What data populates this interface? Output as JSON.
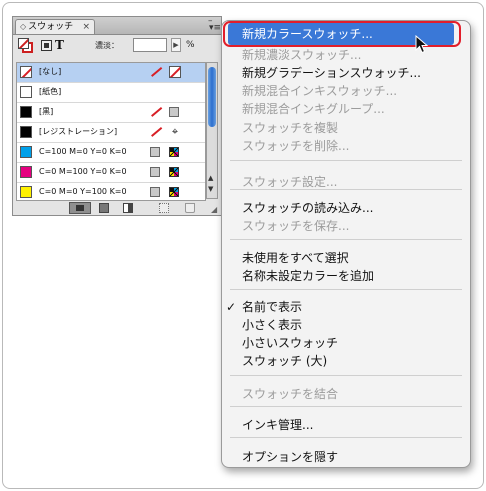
{
  "panel": {
    "tab_grip": "◇",
    "tab_label": "スウォッチ",
    "tab_close": "×",
    "minimize": "–",
    "menu_glyph": "▾≡",
    "tint_label": "濃淡：",
    "tint_value": "",
    "tint_arrow": "▶",
    "percent": "%",
    "text_icon_label": "T",
    "scroll_up": "▲",
    "scroll_down": "▼",
    "resize_glyph": "◢",
    "swatches": [
      {
        "name": "[なし]",
        "color": "none",
        "icons": [
          "no-edit",
          "none-box"
        ],
        "selected": true
      },
      {
        "name": "[紙色]",
        "color": "#ffffff",
        "icons": [],
        "selected": false
      },
      {
        "name": "[黒]",
        "color": "#000000",
        "icons": [
          "no-edit",
          "process-gray"
        ],
        "selected": false
      },
      {
        "name": "[レジストレーション]",
        "color": "#000000",
        "icons": [
          "no-edit",
          "registration"
        ],
        "selected": false
      },
      {
        "name": "C=100 M=0 Y=0 K=0",
        "color": "#00a0e9",
        "icons": [
          "process-gray",
          "cmyk"
        ],
        "selected": false
      },
      {
        "name": "C=0 M=100 Y=0 K=0",
        "color": "#e4007f",
        "icons": [
          "process-gray",
          "cmyk"
        ],
        "selected": false
      },
      {
        "name": "C=0 M=0 Y=100 K=0",
        "color": "#fff100",
        "icons": [
          "process-gray",
          "cmyk"
        ],
        "selected": false
      }
    ]
  },
  "menu": {
    "items": [
      {
        "label": "新規カラースウォッチ...",
        "state": "highlighted"
      },
      {
        "label": "新規濃淡スウォッチ...",
        "state": "disabled"
      },
      {
        "label": "新規グラデーションスウォッチ...",
        "state": "enabled"
      },
      {
        "label": "新規混合インキスウォッチ...",
        "state": "disabled"
      },
      {
        "label": "新規混合インキグループ...",
        "state": "disabled"
      },
      {
        "label": "スウォッチを複製",
        "state": "disabled"
      },
      {
        "label": "スウォッチを削除...",
        "state": "disabled"
      },
      {
        "label": "スウォッチ設定...",
        "state": "disabled"
      },
      {
        "label": "スウォッチの読み込み...",
        "state": "enabled"
      },
      {
        "label": "スウォッチを保存...",
        "state": "disabled"
      },
      {
        "label": "未使用をすべて選択",
        "state": "enabled"
      },
      {
        "label": "名称未設定カラーを追加",
        "state": "enabled"
      },
      {
        "label": "名前で表示",
        "state": "checked"
      },
      {
        "label": "小さく表示",
        "state": "enabled"
      },
      {
        "label": "小さいスウォッチ",
        "state": "enabled"
      },
      {
        "label": "スウォッチ (大)",
        "state": "enabled"
      },
      {
        "label": "スウォッチを結合",
        "state": "disabled"
      },
      {
        "label": "インキ管理...",
        "state": "enabled"
      },
      {
        "label": "オプションを隠す",
        "state": "enabled"
      }
    ],
    "check_glyph": "✓"
  },
  "colors": {
    "highlight": "#3a78d7",
    "annotation_ring": "#e21e2a",
    "selected_row": "#b6d0f2",
    "disabled_text": "#9c9c9c"
  }
}
